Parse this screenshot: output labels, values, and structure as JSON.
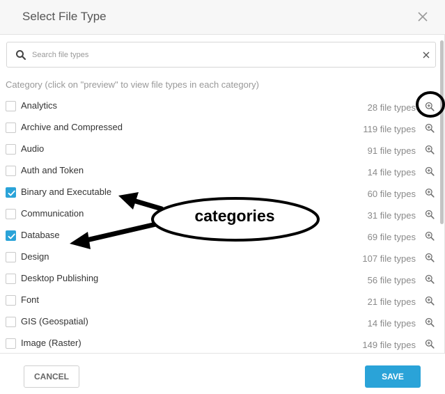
{
  "dialog": {
    "title": "Select File Type"
  },
  "search": {
    "placeholder": "Search file types",
    "value": ""
  },
  "category_label": "Category (click on \"preview\" to view file types in each category)",
  "categories": [
    {
      "name": "Analytics",
      "count": "28 file types",
      "checked": false
    },
    {
      "name": "Archive and Compressed",
      "count": "119 file types",
      "checked": false
    },
    {
      "name": "Audio",
      "count": "91 file types",
      "checked": false
    },
    {
      "name": "Auth and Token",
      "count": "14 file types",
      "checked": false
    },
    {
      "name": "Binary and Executable",
      "count": "60 file types",
      "checked": true
    },
    {
      "name": "Communication",
      "count": "31 file types",
      "checked": false
    },
    {
      "name": "Database",
      "count": "69 file types",
      "checked": true
    },
    {
      "name": "Design",
      "count": "107 file types",
      "checked": false
    },
    {
      "name": "Desktop Publishing",
      "count": "56 file types",
      "checked": false
    },
    {
      "name": "Font",
      "count": "21 file types",
      "checked": false
    },
    {
      "name": "GIS (Geospatial)",
      "count": "14 file types",
      "checked": false
    },
    {
      "name": "Image (Raster)",
      "count": "149 file types",
      "checked": false
    }
  ],
  "footer": {
    "cancel_label": "CANCEL",
    "save_label": "SAVE"
  },
  "annotation": {
    "callout_text": "categories"
  },
  "colors": {
    "accent": "#2aa3d8",
    "checkbox_border": "#c9c9c9",
    "header_bg": "#f7f7f7"
  }
}
